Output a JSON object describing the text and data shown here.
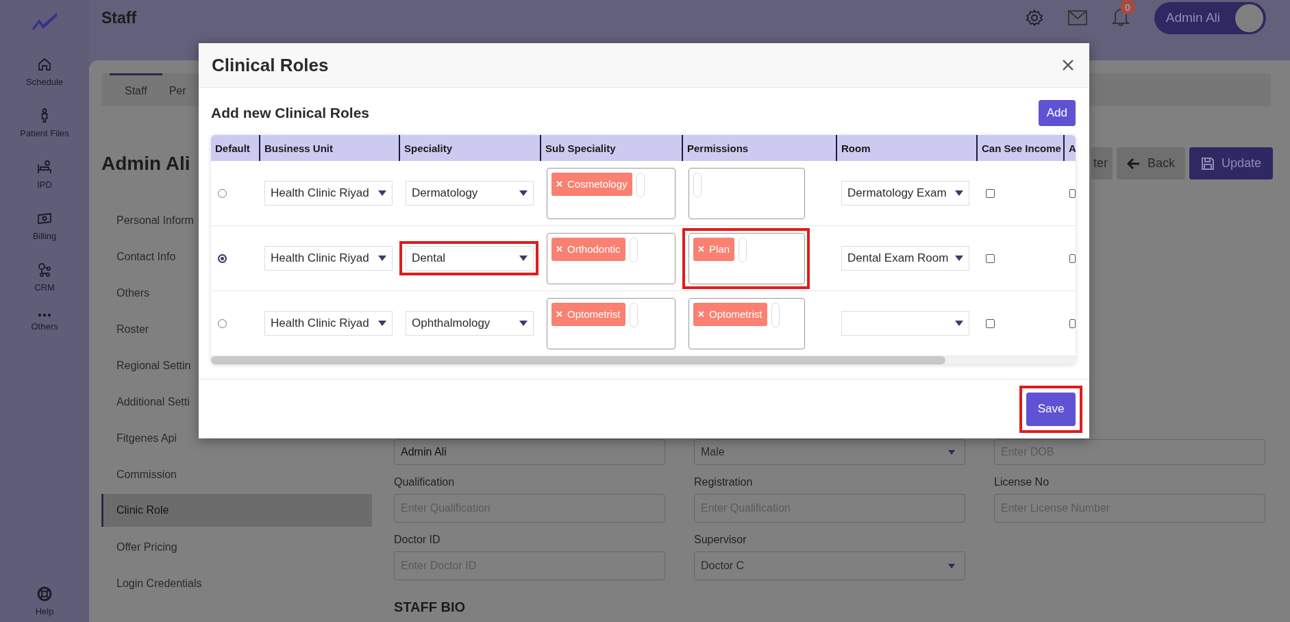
{
  "sidebar": {
    "items": [
      {
        "label": "Schedule"
      },
      {
        "label": "Patient Files"
      },
      {
        "label": "IPD"
      },
      {
        "label": "Billing"
      },
      {
        "label": "CRM"
      },
      {
        "label": "Others"
      }
    ],
    "footer": {
      "label": "Help"
    }
  },
  "header": {
    "title": "Staff",
    "notification_count": "0",
    "user": "Admin Ali"
  },
  "tabs": [
    {
      "label": "Staff",
      "selected": true
    },
    {
      "label": "Per",
      "selected": false
    }
  ],
  "profile_name": "Admin Ali",
  "actions": [
    {
      "label": "ter",
      "kind": "plain"
    },
    {
      "label": "Back",
      "kind": "back"
    },
    {
      "label": "Update",
      "kind": "primary"
    }
  ],
  "nav": [
    {
      "label": "Personal Inform",
      "selected": false
    },
    {
      "label": "Contact Info",
      "selected": false
    },
    {
      "label": "Others",
      "selected": false
    },
    {
      "label": "Roster",
      "selected": false
    },
    {
      "label": "Regional Settin",
      "selected": false
    },
    {
      "label": "Additional Setti",
      "selected": false
    },
    {
      "label": "Fitgenes Api",
      "selected": false
    },
    {
      "label": "Commission",
      "selected": false
    },
    {
      "label": "Clinic Role",
      "selected": true
    },
    {
      "label": "Offer Pricing",
      "selected": false
    },
    {
      "label": "Login Credentials",
      "selected": false
    }
  ],
  "form": {
    "rows": [
      [
        {
          "kind": "input",
          "value": "Admin Ali"
        },
        {
          "kind": "select",
          "value": "Male"
        },
        {
          "kind": "input",
          "placeholder": "Enter DOB"
        }
      ],
      [
        {
          "kind": "input",
          "label": "Qualification",
          "placeholder": "Enter Qualification"
        },
        {
          "kind": "input",
          "label": "Registration",
          "placeholder": "Enter Qualification"
        },
        {
          "kind": "input",
          "label": "License No",
          "placeholder": "Enter License Number"
        }
      ],
      [
        {
          "kind": "input",
          "label": "Doctor ID",
          "placeholder": "Enter Doctor ID"
        },
        {
          "kind": "select",
          "label": "Supervisor",
          "value": "Doctor C"
        }
      ]
    ],
    "section_title": "STAFF BIO"
  },
  "modal": {
    "title": "Clinical Roles",
    "subtitle": "Add new Clinical Roles",
    "add_button": "Add",
    "columns": [
      "Default",
      "Business Unit",
      "Speciality",
      "Sub Speciality",
      "Permissions",
      "Room",
      "Can See Income",
      "A"
    ],
    "rows": [
      {
        "default": false,
        "business_unit": "Health Clinic Riyad",
        "speciality": {
          "value": "Dermatology",
          "highlighted": false
        },
        "sub_speciality": {
          "tags": [
            "Cosmetology"
          ],
          "highlighted": false
        },
        "permissions": {
          "highlighted": false
        },
        "room": "Dermatology Exam",
        "can_see_income": false,
        "column_8": false
      },
      {
        "default": true,
        "business_unit": "Health Clinic Riyad",
        "speciality": {
          "value": "Dental",
          "highlighted": true
        },
        "sub_speciality": {
          "tags": [
            "Orthodontic"
          ],
          "highlighted": false
        },
        "permissions": {
          "tags": [
            "Plan"
          ],
          "highlighted": true
        },
        "room": "Dental Exam Room",
        "can_see_income": false,
        "column_8": false
      },
      {
        "default": false,
        "business_unit": "Health Clinic Riyad",
        "speciality": {
          "value": "Ophthalmology",
          "highlighted": false
        },
        "sub_speciality": {
          "tags": [
            "Optometrist"
          ],
          "highlighted": false
        },
        "permissions": {
          "tags": [
            "Optometrist"
          ],
          "highlighted": false
        },
        "can_see_income": false,
        "column_8": false
      }
    ],
    "save_button": {
      "label": "Save",
      "highlighted": true
    }
  }
}
